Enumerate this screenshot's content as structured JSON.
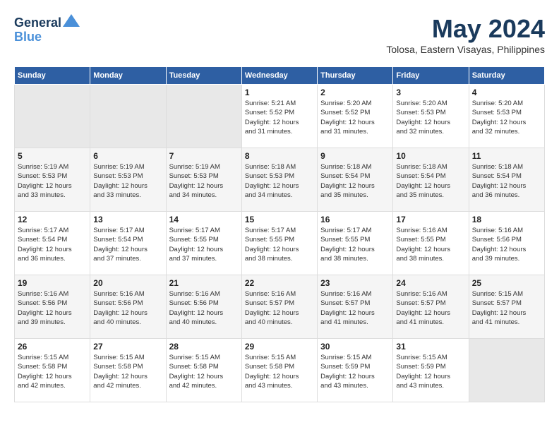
{
  "header": {
    "logo_line1": "General",
    "logo_line2": "Blue",
    "month_title": "May 2024",
    "location": "Tolosa, Eastern Visayas, Philippines"
  },
  "weekdays": [
    "Sunday",
    "Monday",
    "Tuesday",
    "Wednesday",
    "Thursday",
    "Friday",
    "Saturday"
  ],
  "weeks": [
    {
      "days": [
        {
          "number": "",
          "empty": true
        },
        {
          "number": "",
          "empty": true
        },
        {
          "number": "",
          "empty": true
        },
        {
          "number": "1",
          "sunrise": "5:21 AM",
          "sunset": "5:52 PM",
          "daylight": "12 hours and 31 minutes."
        },
        {
          "number": "2",
          "sunrise": "5:20 AM",
          "sunset": "5:52 PM",
          "daylight": "12 hours and 31 minutes."
        },
        {
          "number": "3",
          "sunrise": "5:20 AM",
          "sunset": "5:53 PM",
          "daylight": "12 hours and 32 minutes."
        },
        {
          "number": "4",
          "sunrise": "5:20 AM",
          "sunset": "5:53 PM",
          "daylight": "12 hours and 32 minutes."
        }
      ]
    },
    {
      "days": [
        {
          "number": "5",
          "sunrise": "5:19 AM",
          "sunset": "5:53 PM",
          "daylight": "12 hours and 33 minutes."
        },
        {
          "number": "6",
          "sunrise": "5:19 AM",
          "sunset": "5:53 PM",
          "daylight": "12 hours and 33 minutes."
        },
        {
          "number": "7",
          "sunrise": "5:19 AM",
          "sunset": "5:53 PM",
          "daylight": "12 hours and 34 minutes."
        },
        {
          "number": "8",
          "sunrise": "5:18 AM",
          "sunset": "5:53 PM",
          "daylight": "12 hours and 34 minutes."
        },
        {
          "number": "9",
          "sunrise": "5:18 AM",
          "sunset": "5:54 PM",
          "daylight": "12 hours and 35 minutes."
        },
        {
          "number": "10",
          "sunrise": "5:18 AM",
          "sunset": "5:54 PM",
          "daylight": "12 hours and 35 minutes."
        },
        {
          "number": "11",
          "sunrise": "5:18 AM",
          "sunset": "5:54 PM",
          "daylight": "12 hours and 36 minutes."
        }
      ]
    },
    {
      "days": [
        {
          "number": "12",
          "sunrise": "5:17 AM",
          "sunset": "5:54 PM",
          "daylight": "12 hours and 36 minutes."
        },
        {
          "number": "13",
          "sunrise": "5:17 AM",
          "sunset": "5:54 PM",
          "daylight": "12 hours and 37 minutes."
        },
        {
          "number": "14",
          "sunrise": "5:17 AM",
          "sunset": "5:55 PM",
          "daylight": "12 hours and 37 minutes."
        },
        {
          "number": "15",
          "sunrise": "5:17 AM",
          "sunset": "5:55 PM",
          "daylight": "12 hours and 38 minutes."
        },
        {
          "number": "16",
          "sunrise": "5:17 AM",
          "sunset": "5:55 PM",
          "daylight": "12 hours and 38 minutes."
        },
        {
          "number": "17",
          "sunrise": "5:16 AM",
          "sunset": "5:55 PM",
          "daylight": "12 hours and 38 minutes."
        },
        {
          "number": "18",
          "sunrise": "5:16 AM",
          "sunset": "5:56 PM",
          "daylight": "12 hours and 39 minutes."
        }
      ]
    },
    {
      "days": [
        {
          "number": "19",
          "sunrise": "5:16 AM",
          "sunset": "5:56 PM",
          "daylight": "12 hours and 39 minutes."
        },
        {
          "number": "20",
          "sunrise": "5:16 AM",
          "sunset": "5:56 PM",
          "daylight": "12 hours and 40 minutes."
        },
        {
          "number": "21",
          "sunrise": "5:16 AM",
          "sunset": "5:56 PM",
          "daylight": "12 hours and 40 minutes."
        },
        {
          "number": "22",
          "sunrise": "5:16 AM",
          "sunset": "5:57 PM",
          "daylight": "12 hours and 40 minutes."
        },
        {
          "number": "23",
          "sunrise": "5:16 AM",
          "sunset": "5:57 PM",
          "daylight": "12 hours and 41 minutes."
        },
        {
          "number": "24",
          "sunrise": "5:16 AM",
          "sunset": "5:57 PM",
          "daylight": "12 hours and 41 minutes."
        },
        {
          "number": "25",
          "sunrise": "5:15 AM",
          "sunset": "5:57 PM",
          "daylight": "12 hours and 41 minutes."
        }
      ]
    },
    {
      "days": [
        {
          "number": "26",
          "sunrise": "5:15 AM",
          "sunset": "5:58 PM",
          "daylight": "12 hours and 42 minutes."
        },
        {
          "number": "27",
          "sunrise": "5:15 AM",
          "sunset": "5:58 PM",
          "daylight": "12 hours and 42 minutes."
        },
        {
          "number": "28",
          "sunrise": "5:15 AM",
          "sunset": "5:58 PM",
          "daylight": "12 hours and 42 minutes."
        },
        {
          "number": "29",
          "sunrise": "5:15 AM",
          "sunset": "5:58 PM",
          "daylight": "12 hours and 43 minutes."
        },
        {
          "number": "30",
          "sunrise": "5:15 AM",
          "sunset": "5:59 PM",
          "daylight": "12 hours and 43 minutes."
        },
        {
          "number": "31",
          "sunrise": "5:15 AM",
          "sunset": "5:59 PM",
          "daylight": "12 hours and 43 minutes."
        },
        {
          "number": "",
          "empty": true
        }
      ]
    }
  ],
  "labels": {
    "sunrise": "Sunrise:",
    "sunset": "Sunset:",
    "daylight": "Daylight:"
  }
}
